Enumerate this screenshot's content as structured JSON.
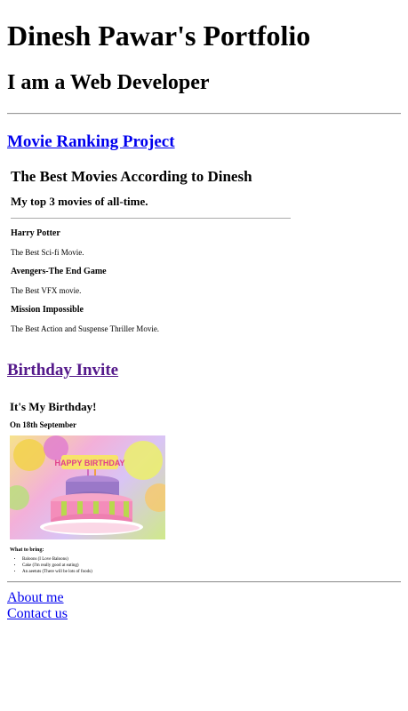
{
  "header": {
    "title": "Dinesh Pawar's Portfolio",
    "subtitle": "I am a Web Developer"
  },
  "projects": {
    "movie_link": "Movie Ranking Project",
    "birthday_link": "Birthday Invite"
  },
  "movie_page": {
    "heading": "The Best Movies According to Dinesh",
    "subheading": "My top 3 movies of all-time.",
    "movies": [
      {
        "title": "Harry Potter",
        "description": "The Best Sci-fi Movie."
      },
      {
        "title": "Avengers-The End Game",
        "description": "The Best VFX movie."
      },
      {
        "title": "Mission Impossible",
        "description": "The Best Action and Suspense Thriller Movie."
      }
    ]
  },
  "birthday_page": {
    "heading": "It's My Birthday!",
    "date": "On 18th September",
    "cake_text": "HAPPY BIRTHDAY",
    "bring_label": "What to bring:",
    "items": [
      "Baloons (I Love Baloons)",
      "Cake (I'm really good at eating)",
      "An aeetuts (There will be lots of foods)"
    ]
  },
  "footer": {
    "about": "About me",
    "contact": "Contact us"
  },
  "colors": {
    "link": "#0000ee",
    "visited_link": "#551a8b"
  }
}
